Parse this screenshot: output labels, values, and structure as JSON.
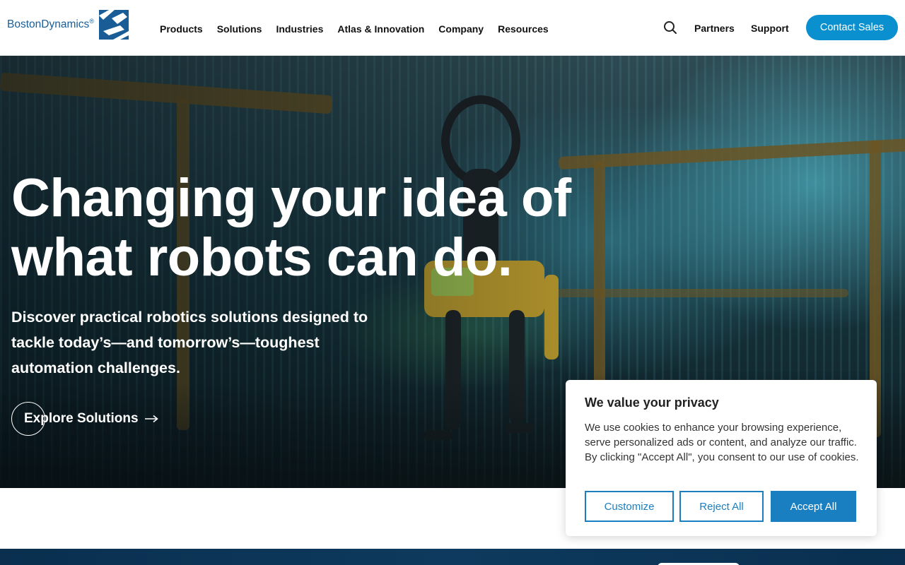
{
  "header": {
    "logo": {
      "part1": "Boston",
      "part2": "Dynamics",
      "reg": "®"
    },
    "nav": [
      "Products",
      "Solutions",
      "Industries",
      "Atlas & Innovation",
      "Company",
      "Resources"
    ],
    "search_icon": "search-icon",
    "partners": "Partners",
    "support": "Support",
    "contact_sales": "Contact Sales"
  },
  "hero": {
    "title_line1": "Changing your idea of",
    "title_line2": "what robots can do.",
    "subtitle": "Discover practical robotics solutions designed to tackle today’s—and tomorrow’s—toughest automation challenges.",
    "cta": "Explore Solutions",
    "cta_icon": "arrow-right-icon"
  },
  "cookie": {
    "title": "We value your privacy",
    "body": "We use cookies to enhance your browsing experience, serve personalized ads or content, and analyze our traffic. By clicking \"Accept All\", you consent to our use of cookies.",
    "customize": "Customize",
    "reject": "Reject All",
    "accept": "Accept All"
  },
  "colors": {
    "brand_blue": "#1a5d96",
    "contact_button": "#0a8fcf",
    "cookie_accent": "#1a7fc1"
  }
}
